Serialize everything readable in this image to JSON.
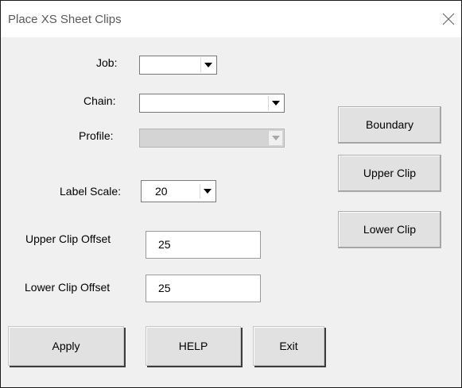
{
  "window": {
    "title": "Place XS Sheet Clips"
  },
  "icons": {
    "close": "close-x-icon",
    "dropdown": "triangle-down-icon"
  },
  "fields": {
    "job": {
      "label": "Job:",
      "value": ""
    },
    "chain": {
      "label": "Chain:",
      "value": ""
    },
    "profile": {
      "label": "Profile:",
      "value": "",
      "disabled": true
    },
    "label_scale": {
      "label": "Label Scale:",
      "value": "20"
    },
    "upper_clip_offset": {
      "label": "Upper Clip Offset",
      "value": "25"
    },
    "lower_clip_offset": {
      "label": "Lower Clip Offset",
      "value": "25"
    }
  },
  "side_buttons": {
    "boundary": "Boundary",
    "upper_clip": "Upper Clip",
    "lower_clip": "Lower Clip"
  },
  "bottom_buttons": {
    "apply": "Apply",
    "help": "HELP",
    "exit": "Exit"
  }
}
